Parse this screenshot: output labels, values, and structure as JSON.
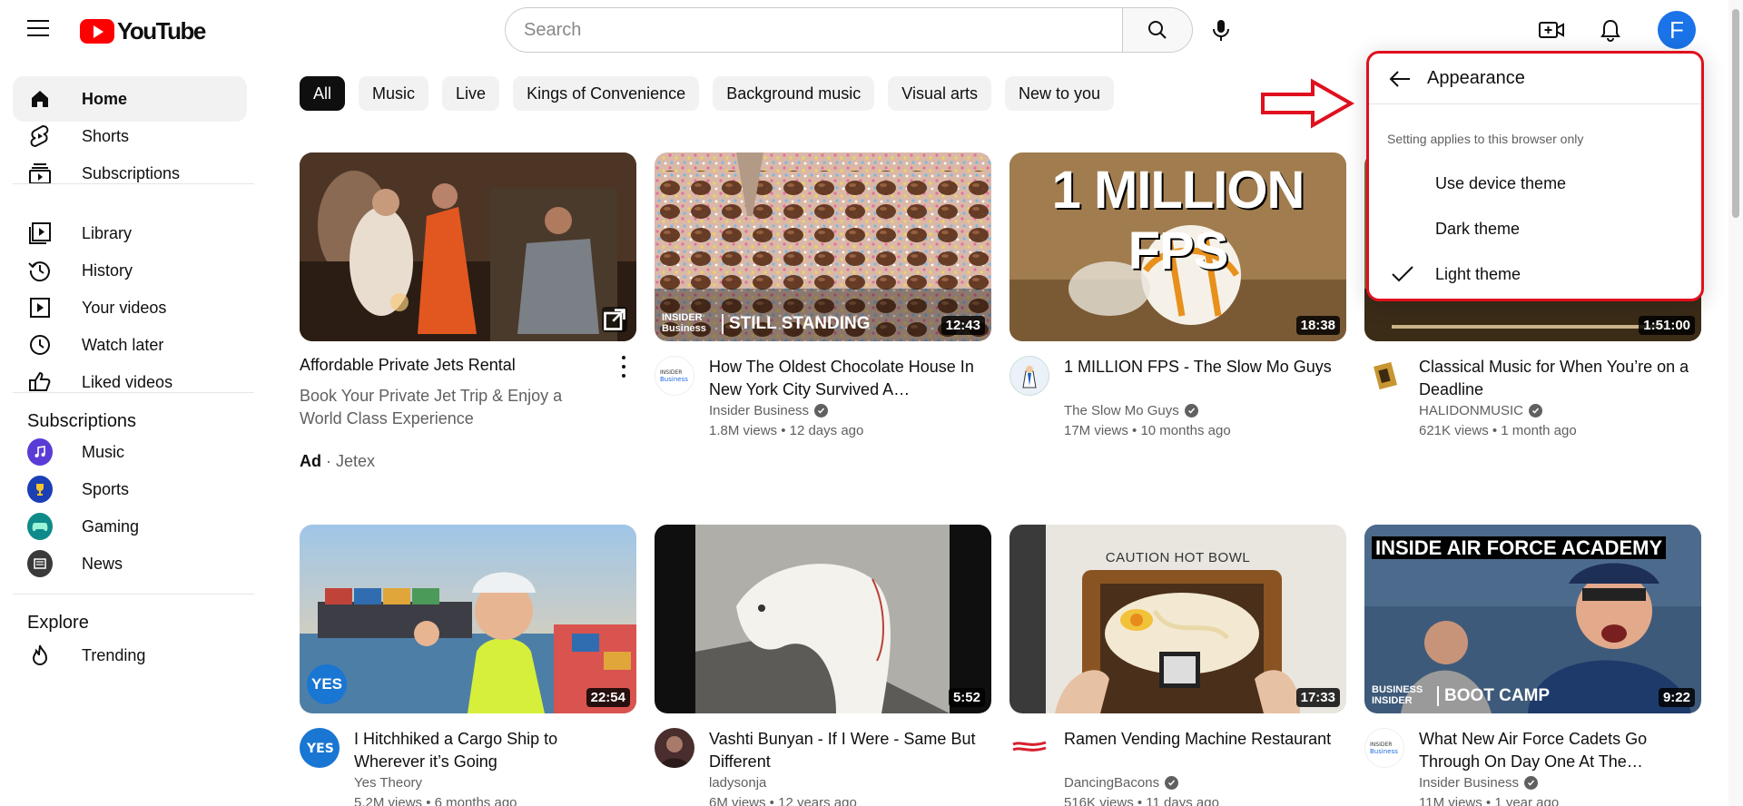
{
  "header": {
    "logo_text": "YouTube",
    "search_placeholder": "Search",
    "avatar_letter": "F"
  },
  "sidebar": {
    "main": [
      {
        "label": "Home",
        "icon": "home-icon",
        "active": true
      },
      {
        "label": "Shorts",
        "icon": "shorts-icon"
      },
      {
        "label": "Subscriptions",
        "icon": "subscriptions-icon"
      }
    ],
    "library": [
      {
        "label": "Library",
        "icon": "library-icon"
      },
      {
        "label": "History",
        "icon": "history-icon"
      },
      {
        "label": "Your videos",
        "icon": "your-videos-icon"
      },
      {
        "label": "Watch later",
        "icon": "watch-later-icon"
      },
      {
        "label": "Liked videos",
        "icon": "thumbs-up-icon"
      }
    ],
    "subscriptions_heading": "Subscriptions",
    "subscriptions": [
      {
        "label": "Music",
        "color": "#5b3bd6"
      },
      {
        "label": "Sports",
        "color": "#1b3fb5"
      },
      {
        "label": "Gaming",
        "color": "#0f8a8a"
      },
      {
        "label": "News",
        "color": "#3a3a3a"
      }
    ],
    "explore_heading": "Explore",
    "explore": [
      {
        "label": "Trending",
        "icon": "trending-icon"
      }
    ]
  },
  "chips": [
    "All",
    "Music",
    "Live",
    "Kings of Convenience",
    "Background music",
    "Visual arts",
    "New to you"
  ],
  "ad": {
    "title": "Affordable Private Jets Rental",
    "description": "Book Your Private Jet Trip & Enjoy a World Class Experience",
    "ad_label": "Ad",
    "separator": "·",
    "advertiser": "Jetex"
  },
  "videos": [
    {
      "title": "How The Oldest Chocolate House In New York City Survived A…",
      "channel": "Insider Business",
      "stats": "1.8M views • 12 days ago",
      "duration": "12:43",
      "thumb_text": "STILL STANDING",
      "thumb_brand": "INSIDER Business"
    },
    {
      "title": "1 MILLION FPS - The Slow Mo Guys",
      "channel": "The Slow Mo Guys",
      "stats": "17M views • 10 months ago",
      "duration": "18:38",
      "thumb_text": "1 MILLION FPS"
    },
    {
      "title": "Classical Music for When You’re on a Deadline",
      "channel": "HALIDONMUSIC",
      "stats": "621K views • 1 month ago",
      "duration": "1:51:00"
    },
    {
      "title": "I Hitchhiked a Cargo Ship to Wherever it’s Going",
      "channel": "Yes Theory",
      "stats": "5.2M views • 6 months ago",
      "duration": "22:54",
      "thumb_text": "YES"
    },
    {
      "title": "Vashti Bunyan - If I Were - Same But Different",
      "channel": "ladysonja",
      "stats": "6M views • 12 years ago",
      "duration": "5:52"
    },
    {
      "title": "Ramen Vending Machine Restaurant",
      "channel": "DancingBacons",
      "stats": "516K views • 11 days ago",
      "duration": "17:33",
      "thumb_text": "CAUTION HOT BOWL"
    },
    {
      "title": "What New Air Force Cadets Go Through On Day One At The…",
      "channel": "Insider Business",
      "stats": "11M views • 1 year ago",
      "duration": "9:22",
      "thumb_text": "INSIDE AIR FORCE ACADEMY",
      "thumb_text2": "BOOT CAMP",
      "thumb_brand": "BUSINESS INSIDER"
    }
  ],
  "appearance_menu": {
    "title": "Appearance",
    "note": "Setting applies to this browser only",
    "options": [
      {
        "label": "Use device theme",
        "checked": false
      },
      {
        "label": "Dark theme",
        "checked": false
      },
      {
        "label": "Light theme",
        "checked": true
      }
    ]
  }
}
